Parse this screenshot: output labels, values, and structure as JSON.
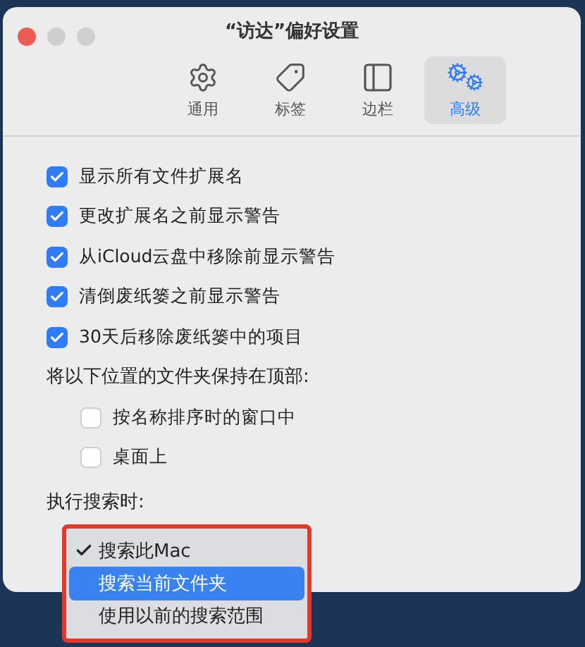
{
  "window": {
    "title": "“访达”偏好设置"
  },
  "tabs": [
    {
      "label": "通用",
      "kind": "gear",
      "selected": false
    },
    {
      "label": "标签",
      "kind": "tag",
      "selected": false
    },
    {
      "label": "边栏",
      "kind": "sidebar",
      "selected": false
    },
    {
      "label": "高级",
      "kind": "gears",
      "selected": true
    }
  ],
  "options": [
    {
      "label": "显示所有文件扩展名",
      "checked": true
    },
    {
      "label": "更改扩展名之前显示警告",
      "checked": true
    },
    {
      "label": "从iCloud云盘中移除前显示警告",
      "checked": true
    },
    {
      "label": "清倒废纸篓之前显示警告",
      "checked": true
    },
    {
      "label": "30天后移除废纸篓中的项目",
      "checked": true
    }
  ],
  "keep_on_top": {
    "label": "将以下位置的文件夹保持在顶部:",
    "options": [
      {
        "label": "按名称排序时的窗口中",
        "checked": false
      },
      {
        "label": "桌面上",
        "checked": false
      }
    ]
  },
  "search": {
    "label": "执行搜索时:",
    "menu": [
      {
        "label": "搜索此Mac",
        "checked": true,
        "selected": false
      },
      {
        "label": "搜索当前文件夹",
        "checked": false,
        "selected": true
      },
      {
        "label": "使用以前的搜索范围",
        "checked": false,
        "selected": false
      }
    ]
  }
}
